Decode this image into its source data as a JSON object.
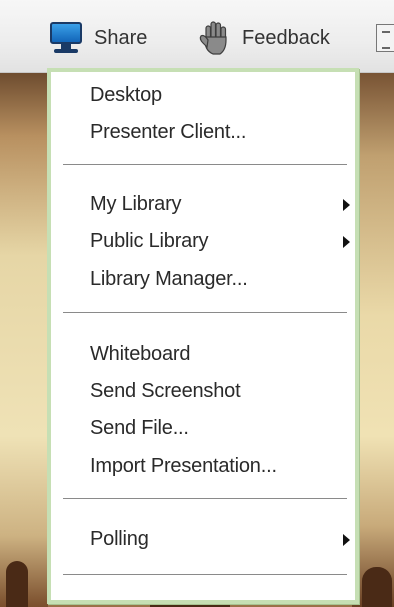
{
  "toolbar": {
    "share_label": "Share",
    "feedback_label": "Feedback"
  },
  "menu": {
    "groups": [
      {
        "items": [
          {
            "label": "Desktop"
          },
          {
            "label": "Presenter Client..."
          }
        ]
      },
      {
        "items": [
          {
            "label": "My Library",
            "has_submenu": true
          },
          {
            "label": "Public Library",
            "has_submenu": true
          },
          {
            "label": "Library Manager..."
          }
        ]
      },
      {
        "items": [
          {
            "label": "Whiteboard"
          },
          {
            "label": "Send Screenshot"
          },
          {
            "label": "Send File..."
          },
          {
            "label": "Import Presentation..."
          }
        ]
      },
      {
        "items": [
          {
            "label": "Polling",
            "has_submenu": true
          }
        ]
      }
    ]
  },
  "colors": {
    "menu_border": "#c6dfb4",
    "menu_background": "#ffffff",
    "text": "#2a2a2a",
    "toolbar_background": "#eeeeee"
  },
  "icons": {
    "share": "monitor-icon",
    "feedback": "hand-icon"
  }
}
